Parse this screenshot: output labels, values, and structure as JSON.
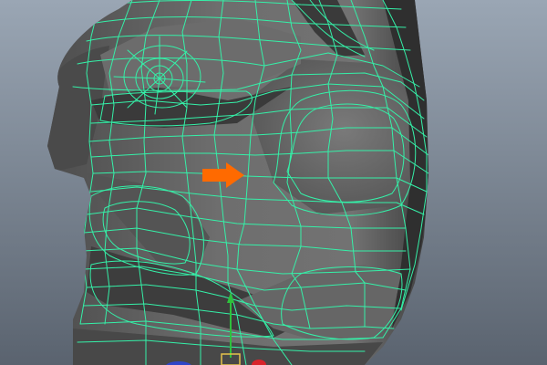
{
  "viewport": {
    "background_top": "#9aa6b4",
    "background_bottom": "#5a636f",
    "mesh_fill": "#6b6b6b",
    "mesh_shadow": "#3c3c3c",
    "mesh_highlight": "#858585",
    "wire_color": "#35f0a8",
    "arrow_color": "#ff6a00",
    "pointer_icon": "arrow-right-icon"
  },
  "manipulator": {
    "y_axis_color": "#2ec13c",
    "x_axis_color": "#d8232a",
    "z_axis_color": "#2f45c8",
    "center_color": "#e6c24a"
  }
}
